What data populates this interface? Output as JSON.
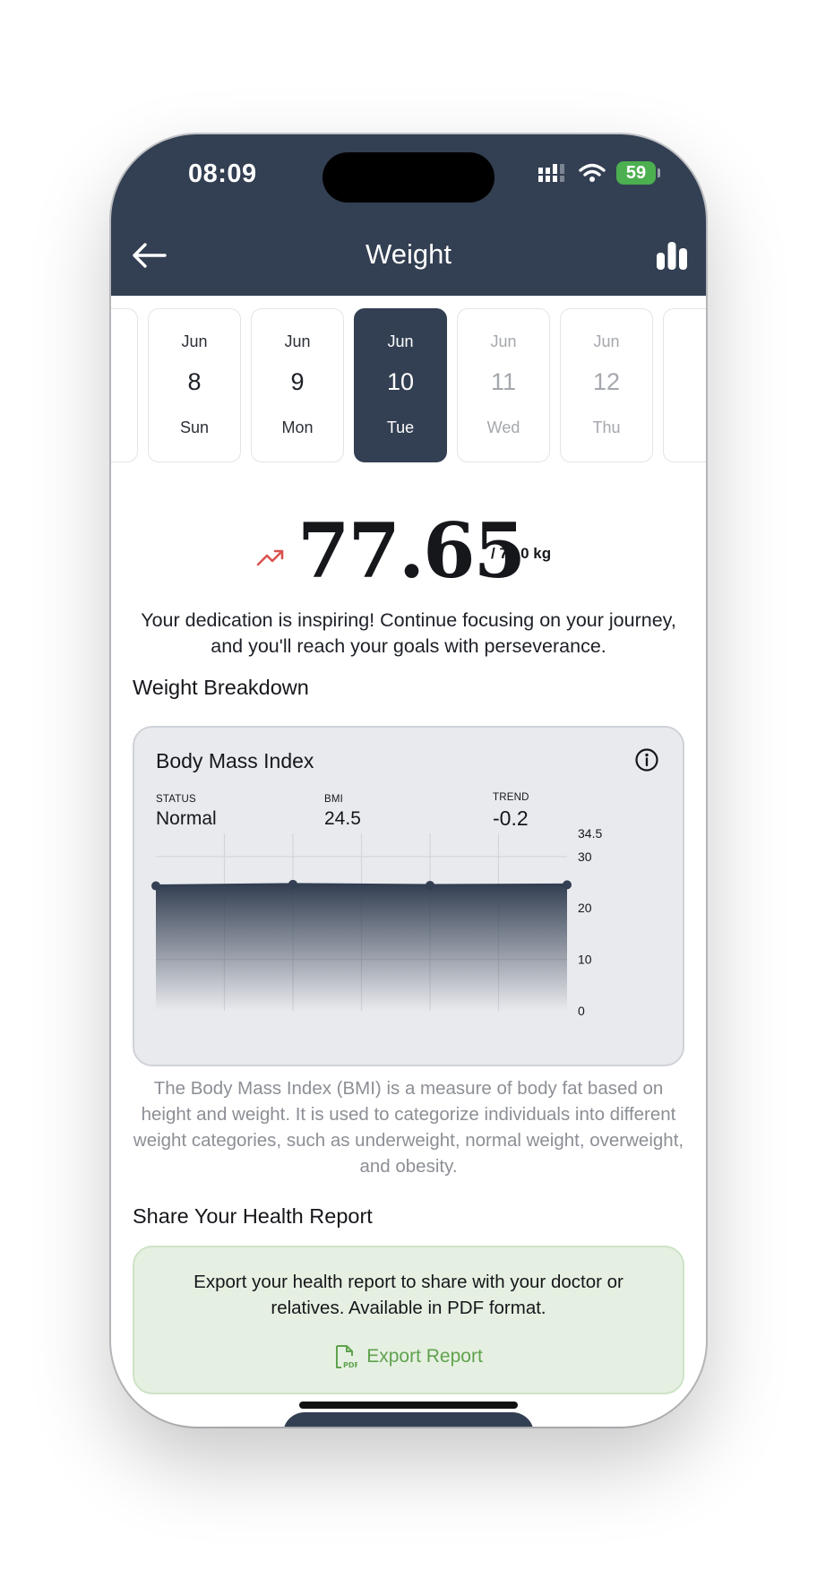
{
  "status_bar": {
    "time": "08:09",
    "battery": "59"
  },
  "nav": {
    "title": "Weight",
    "back_icon": "arrow-left-icon",
    "chart_icon": "bar-chart-icon"
  },
  "dates": [
    {
      "month": "Jun",
      "day": "8",
      "weekday": "Sun",
      "state": "past"
    },
    {
      "month": "Jun",
      "day": "9",
      "weekday": "Mon",
      "state": "past"
    },
    {
      "month": "Jun",
      "day": "10",
      "weekday": "Tue",
      "state": "selected"
    },
    {
      "month": "Jun",
      "day": "11",
      "weekday": "Wed",
      "state": "future"
    },
    {
      "month": "Jun",
      "day": "12",
      "weekday": "Thu",
      "state": "future"
    }
  ],
  "weight": {
    "value": "77.65",
    "goal": "/ 72.0 kg",
    "trend_icon": "trending-up-icon",
    "trend_color": "#d9534f"
  },
  "motivation": "Your dedication is inspiring! Continue focusing on your journey, and you'll reach your goals with perseverance.",
  "breakdown": {
    "section_title": "Weight Breakdown",
    "card_title": "Body Mass Index",
    "stats": {
      "status_label": "STATUS",
      "status_value": "Normal",
      "bmi_label": "BMI",
      "bmi_value": "24.5",
      "trend_label": "TREND",
      "trend_value": "-0.2"
    },
    "description": "The Body Mass Index (BMI) is a measure of body fat based on height and weight. It is used to categorize individuals into different weight categories, such as underweight, normal weight, overweight, and obesity."
  },
  "chart_data": {
    "type": "area",
    "x": [
      1,
      2,
      3,
      4
    ],
    "values": [
      24.3,
      24.6,
      24.4,
      24.5
    ],
    "ylim": [
      0,
      34.5
    ],
    "y_ticks": [
      "34.5",
      "30",
      "20",
      "10",
      "0"
    ],
    "y_tick_values": [
      34.5,
      30,
      20,
      10,
      0
    ],
    "grid": true,
    "line_color": "#333f52"
  },
  "share": {
    "section_title": "Share Your Health Report",
    "text": "Export your health report to share with your doctor or relatives. Available in PDF format.",
    "button_label": "Export Report",
    "button_icon": "pdf-file-icon",
    "accent": "#5fa24e"
  },
  "colors": {
    "header": "#333f52",
    "selected": "#333f52",
    "card_bg": "#e9eaee",
    "export_bg": "#e6f0e2"
  }
}
